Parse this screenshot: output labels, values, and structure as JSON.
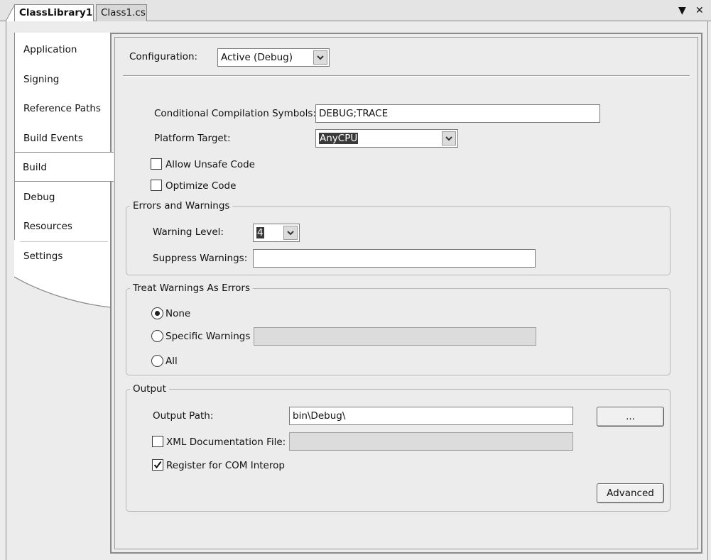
{
  "doc_tabs": [
    {
      "label": "ClassLibrary1"
    },
    {
      "label": "Class1.cs"
    }
  ],
  "strip_icons": {
    "dropdown": "▼",
    "close": "✕"
  },
  "nav": [
    {
      "label": "Application"
    },
    {
      "label": "Signing"
    },
    {
      "label": "Reference Paths"
    },
    {
      "label": "Build Events"
    },
    {
      "label": "Build"
    },
    {
      "label": "Debug"
    },
    {
      "label": "Resources"
    },
    {
      "label": "Settings"
    }
  ],
  "nav_selected": "Build",
  "configuration": {
    "label": "Configuration:",
    "value": "Active (Debug)"
  },
  "general": {
    "symbols_label": "Conditional Compilation Symbols:",
    "symbols_value": "DEBUG;TRACE",
    "platform_label": "Platform Target:",
    "platform_value": "AnyCPU",
    "unsafe_label": "Allow Unsafe Code",
    "unsafe_checked": false,
    "optimize_label": "Optimize Code",
    "optimize_checked": false
  },
  "errors_warnings": {
    "title": "Errors and Warnings",
    "warning_level_label": "Warning Level:",
    "warning_level_value": "4",
    "suppress_label": "Suppress Warnings:",
    "suppress_value": ""
  },
  "treat_warnings": {
    "title": "Treat Warnings As Errors",
    "none_label": "None",
    "specific_label": "Specific Warnings",
    "all_label": "All",
    "selected": "None"
  },
  "output": {
    "title": "Output",
    "path_label": "Output Path:",
    "path_value": "bin\\Debug\\",
    "browse_label": "...",
    "xml_label": "XML Documentation File:",
    "xml_checked": false,
    "com_label": "Register for COM Interop",
    "com_checked": true,
    "advanced_label": "Advanced"
  }
}
